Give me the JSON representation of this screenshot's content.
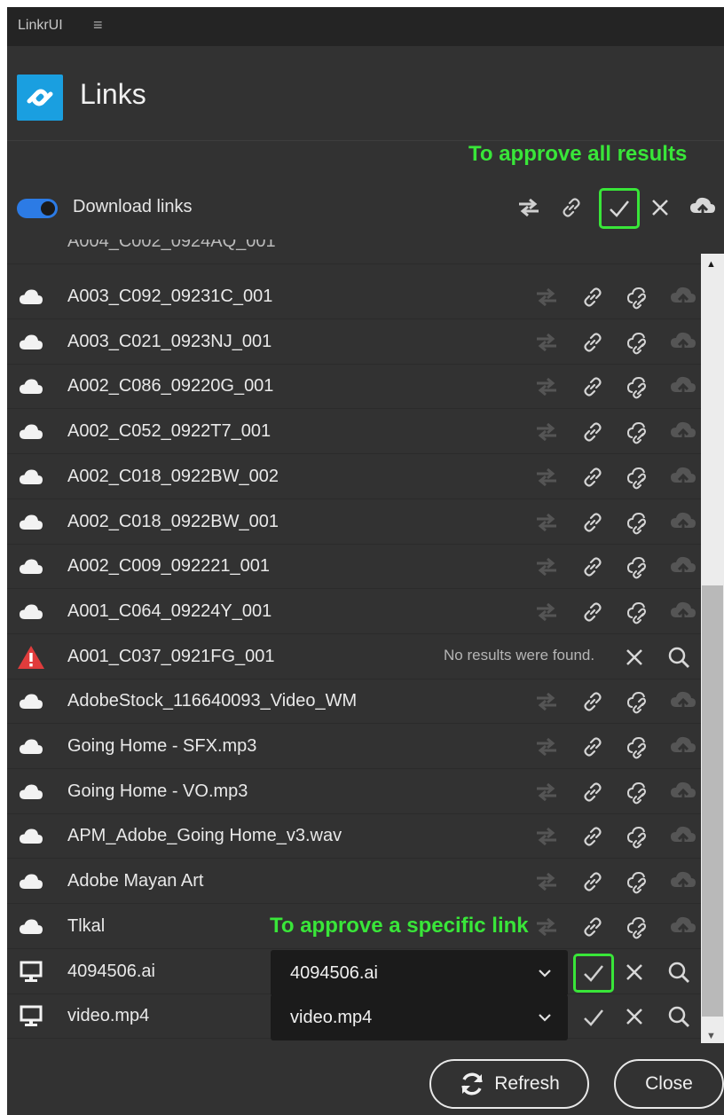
{
  "titlebar": {
    "app_name": "LinkrUI",
    "menu_glyph": "≡"
  },
  "header": {
    "title": "Links"
  },
  "toolbar": {
    "toggle_label": "Download links",
    "toggle_on": true,
    "icons": [
      "swap-arrows-icon",
      "link-icon",
      "approve-all-check-icon",
      "clear-x-icon",
      "cloud-upload-icon"
    ]
  },
  "annotations": {
    "approve_all": "To approve all results",
    "approve_specific": "To approve a specific link"
  },
  "rows": [
    {
      "name": "A003_C092_09231C_001",
      "type": "cloud"
    },
    {
      "name": "A003_C021_0923NJ_001",
      "type": "cloud"
    },
    {
      "name": "A002_C086_09220G_001",
      "type": "cloud"
    },
    {
      "name": "A002_C052_0922T7_001",
      "type": "cloud"
    },
    {
      "name": "A002_C018_0922BW_002",
      "type": "cloud"
    },
    {
      "name": "A002_C018_0922BW_001",
      "type": "cloud"
    },
    {
      "name": "A002_C009_092221_001",
      "type": "cloud"
    },
    {
      "name": "A001_C064_09224Y_001",
      "type": "cloud"
    },
    {
      "name": "A001_C037_0921FG_001",
      "type": "warning",
      "message": "No results were found."
    },
    {
      "name": "AdobeStock_116640093_Video_WM",
      "type": "cloud"
    },
    {
      "name": "Going Home - SFX.mp3",
      "type": "cloud"
    },
    {
      "name": "Going Home - VO.mp3",
      "type": "cloud"
    },
    {
      "name": "APM_Adobe_Going Home_v3.wav",
      "type": "cloud"
    },
    {
      "name": "Adobe Mayan Art",
      "type": "cloud"
    },
    {
      "name": "Tlkal",
      "type": "cloud"
    },
    {
      "name": "4094506.ai",
      "type": "local",
      "selected": "4094506.ai"
    },
    {
      "name": "video.mp4",
      "type": "local",
      "selected": "video.mp4"
    }
  ],
  "footer": {
    "refresh_label": "Refresh",
    "close_label": "Close"
  },
  "colors": {
    "background": "#323232",
    "titlebar": "#242424",
    "accent": "#2c7be5",
    "logo": "#1a9fe0",
    "highlight": "#39e639",
    "warning": "#e03c3c"
  }
}
